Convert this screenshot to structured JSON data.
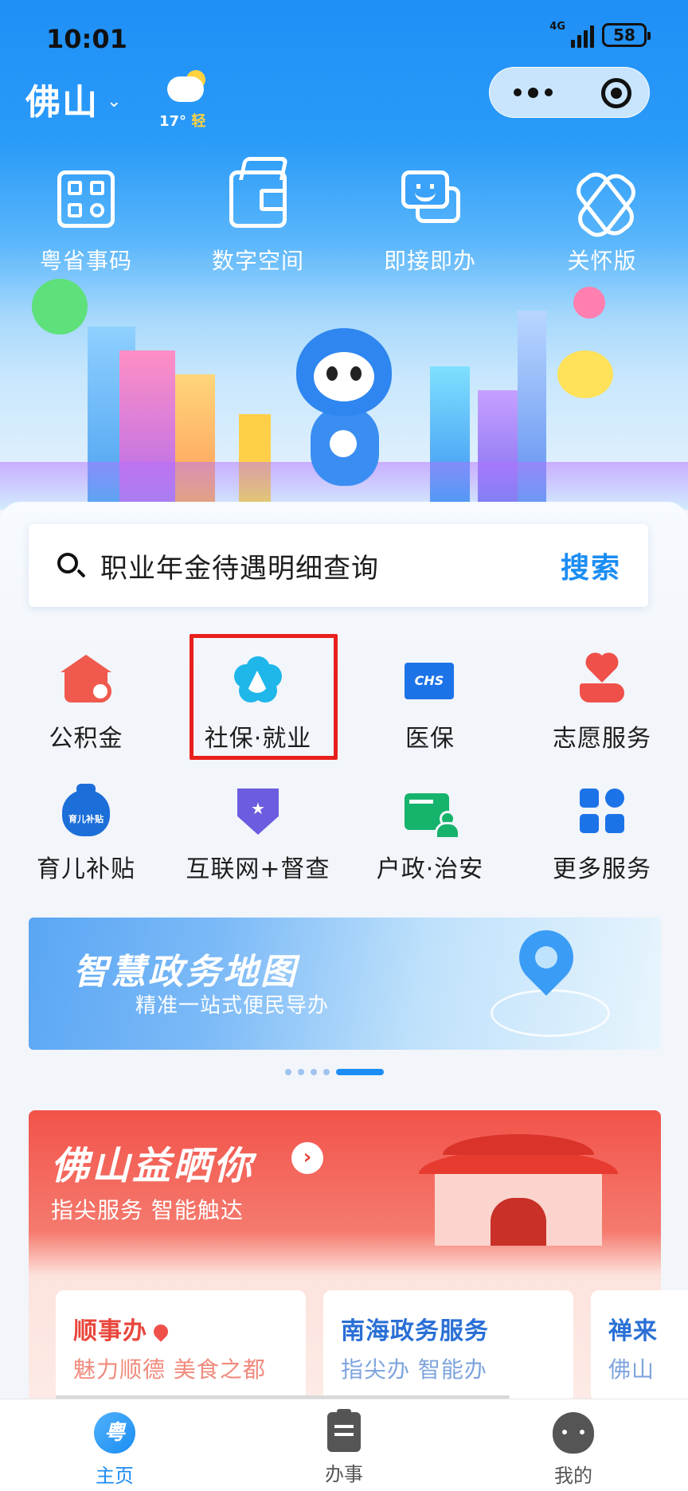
{
  "status_bar": {
    "time": "10:01",
    "network": "4G",
    "battery": "58"
  },
  "header": {
    "city": "佛山",
    "weather": {
      "temperature": "17°",
      "air_quality": "轻"
    }
  },
  "top_shortcuts": [
    {
      "label": "粤省事码",
      "icon": "qr-code-icon"
    },
    {
      "label": "数字空间",
      "icon": "wallet-icon"
    },
    {
      "label": "即接即办",
      "icon": "chat-icon"
    },
    {
      "label": "关怀版",
      "icon": "ribbon-icon"
    }
  ],
  "search": {
    "placeholder": "职业年金待遇明细查询",
    "button_label": "搜索"
  },
  "services": [
    {
      "label": "公积金",
      "icon": "housing-fund-icon"
    },
    {
      "label": "社保·就业",
      "icon": "social-security-icon"
    },
    {
      "label": "医保",
      "icon": "medical-insurance-icon",
      "icon_text": "CHS"
    },
    {
      "label": "志愿服务",
      "icon": "volunteer-icon"
    },
    {
      "label": "育儿补贴",
      "icon": "childcare-subsidy-icon",
      "icon_text": "育儿补贴"
    },
    {
      "label": "互联网+督查",
      "icon": "inspection-icon",
      "icon_text": "★"
    },
    {
      "label": "户政·治安",
      "icon": "household-registration-icon"
    },
    {
      "label": "更多服务",
      "icon": "more-services-icon"
    }
  ],
  "map_banner": {
    "title": "智慧政务地图",
    "subtitle": "精准一站式便民导办"
  },
  "pager": {
    "count": 5,
    "active_index": 4
  },
  "foshan": {
    "title": "佛山益晒你",
    "arrow": "›",
    "subtitle": "指尖服务 智能触达",
    "cards": [
      {
        "title": "顺事办",
        "subtitle": "魅力顺德 美食之都",
        "title_color": "#e8463c",
        "subtitle_color": "#f08a7c"
      },
      {
        "title": "南海政务服务",
        "subtitle": "指尖办 智能办",
        "title_color": "#2a6fd6",
        "subtitle_color": "#7ea4dd"
      },
      {
        "title": "禅来",
        "subtitle": "佛山",
        "title_color": "#2a6fd6",
        "subtitle_color": "#7ea4dd"
      }
    ]
  },
  "tabbar": [
    {
      "label": "主页",
      "icon": "home-icon",
      "icon_text": "粤",
      "active": true
    },
    {
      "label": "办事",
      "icon": "task-icon",
      "active": false
    },
    {
      "label": "我的",
      "icon": "profile-icon",
      "active": false
    }
  ],
  "colors": {
    "brand_blue": "#1b8df3",
    "highlight_red": "#e8201c"
  }
}
